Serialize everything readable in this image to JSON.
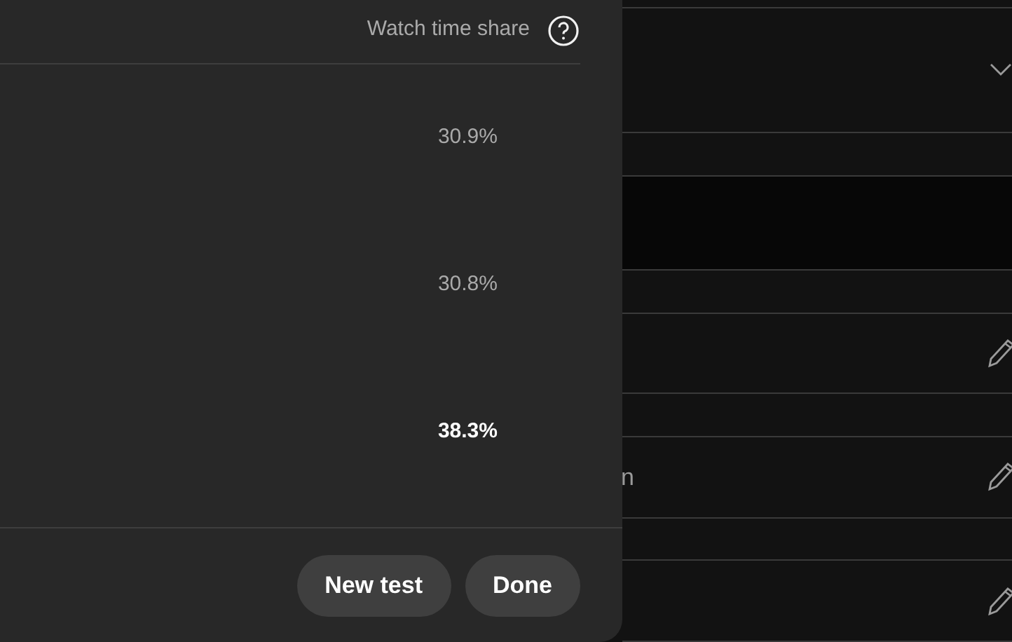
{
  "dialog": {
    "column_header": "Watch time share",
    "results": [
      {
        "share": "30.9%",
        "winner": false
      },
      {
        "share": "30.8%",
        "winner": false
      },
      {
        "share": "38.3%",
        "winner": true
      }
    ],
    "buttons": [
      "New test",
      "Done"
    ]
  },
  "page_behind": {
    "rows": [
      {
        "kind": "dropdown"
      },
      {
        "kind": "spacer"
      },
      {
        "kind": "dark"
      },
      {
        "kind": "spacer"
      },
      {
        "kind": "edit"
      },
      {
        "kind": "spacer"
      },
      {
        "kind": "edit",
        "text": "n"
      },
      {
        "kind": "spacer"
      },
      {
        "kind": "edit"
      }
    ]
  }
}
